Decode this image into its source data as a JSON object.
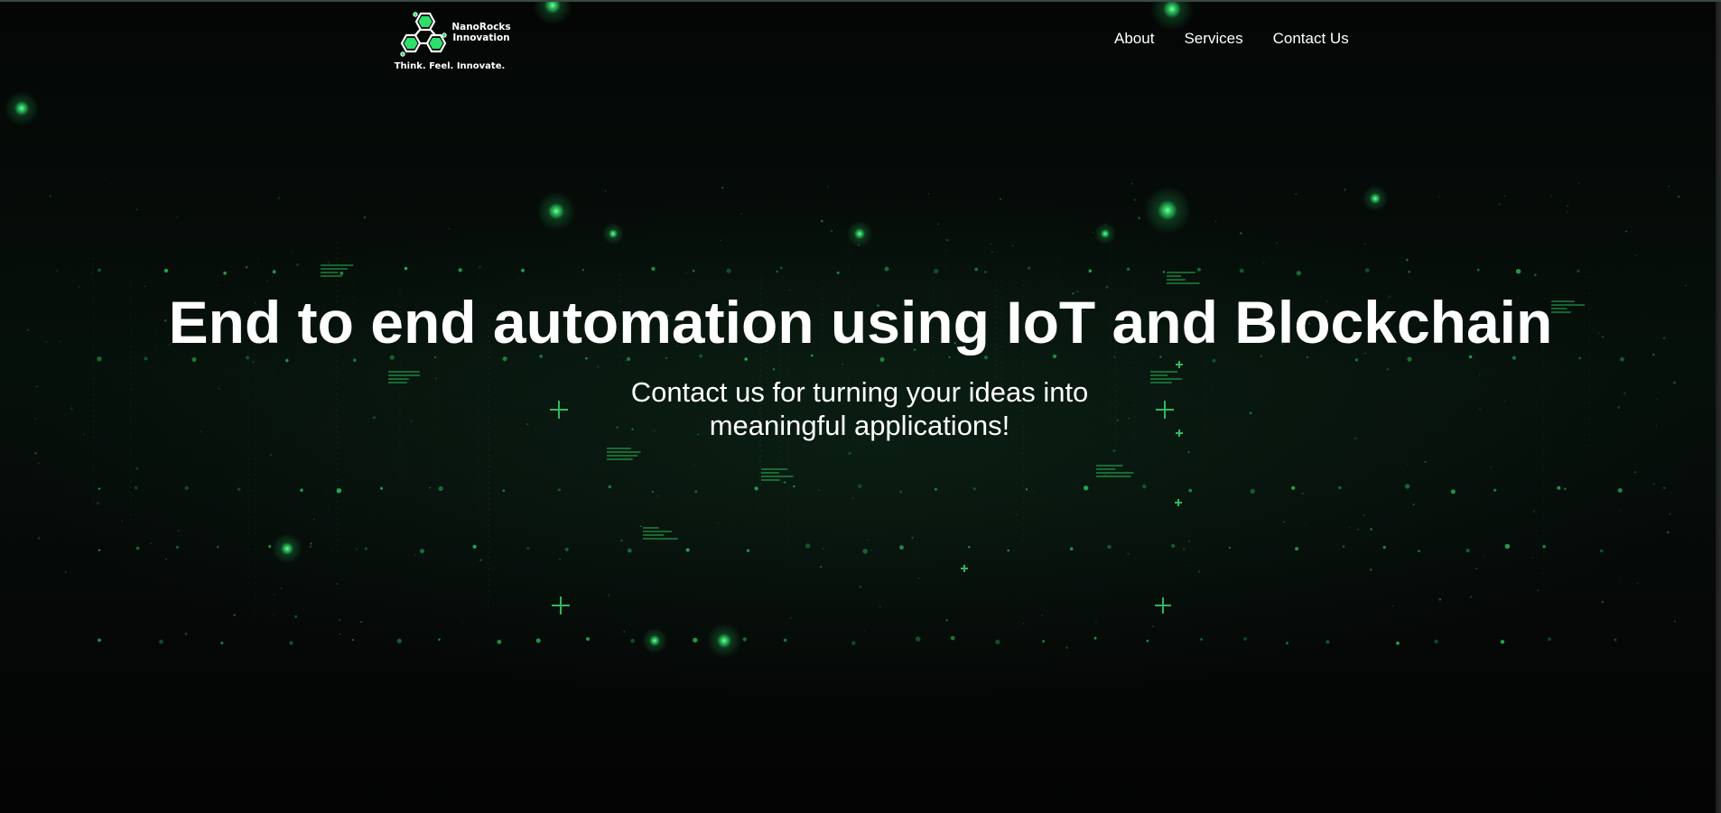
{
  "brand": {
    "name_line1": "NanoRocks",
    "name_line2": "Innovation",
    "tagline": "Think. Feel. Innovate."
  },
  "nav": {
    "items": [
      "About",
      "Services",
      "Contact Us"
    ]
  },
  "hero": {
    "title": "End to end automation using IoT and Blockchain",
    "subtitle": "Contact us for turning your ideas into meaningful applications!"
  },
  "colors": {
    "background": "#050807",
    "accent_green": "#2ee06a",
    "text": "#ffffff"
  },
  "icons": {
    "logo": "hexagon-molecule-icon"
  }
}
